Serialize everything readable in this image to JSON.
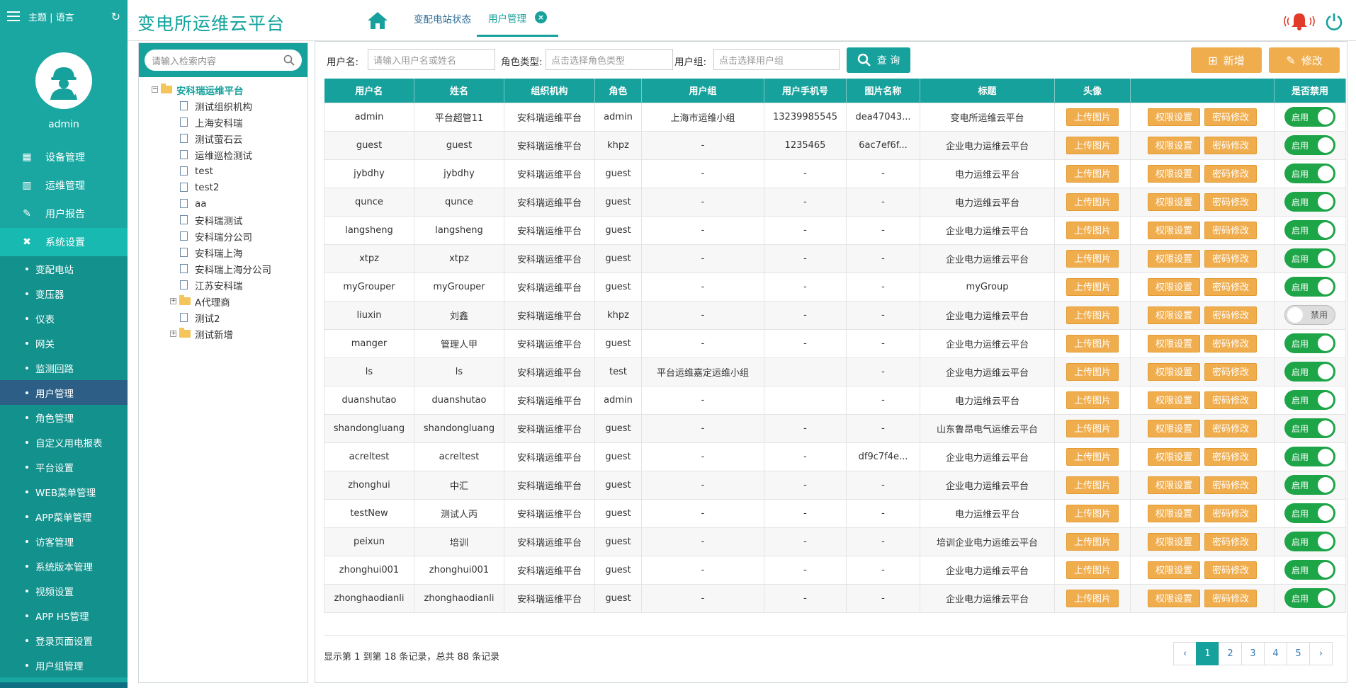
{
  "sidebar": {
    "top_label": "主题 | 语言",
    "user": "admin",
    "nav": [
      {
        "label": "设备管理",
        "icon": "calendar-icon"
      },
      {
        "label": "运维管理",
        "icon": "grid-icon"
      },
      {
        "label": "用户报告",
        "icon": "edit-icon"
      },
      {
        "label": "系统设置",
        "icon": "tools-icon"
      }
    ],
    "sub": [
      "变配电站",
      "变压器",
      "仪表",
      "网关",
      "监测回路",
      "用户管理",
      "角色管理",
      "自定义用电报表",
      "平台设置",
      "WEB菜单管理",
      "APP菜单管理",
      "访客管理",
      "系统版本管理",
      "视频设置",
      "APP H5管理",
      "登录页面设置",
      "用户组管理"
    ]
  },
  "header": {
    "title": "变电所运维云平台",
    "tabs": [
      "变配电站状态",
      "用户管理"
    ]
  },
  "tree": {
    "search_placeholder": "请输入检索内容",
    "root": "安科瑞运维平台",
    "children": [
      "测试组织机构",
      "上海安科瑞",
      "测试萤石云",
      "运维巡检测试",
      "test",
      "test2",
      "aa",
      "安科瑞测试",
      "安科瑞分公司",
      "安科瑞上海",
      "安科瑞上海分公司",
      "江苏安科瑞"
    ],
    "folders": [
      "A代理商",
      "测试2",
      "测试新增"
    ]
  },
  "toolbar": {
    "username_label": "用户名:",
    "username_placeholder": "请输入用户名或姓名",
    "role_label": "角色类型:",
    "role_placeholder": "点击选择角色类型",
    "group_label": "用户组:",
    "group_placeholder": "点击选择用户组",
    "query": "查 询",
    "add": "新增",
    "edit": "修改"
  },
  "table": {
    "headers": [
      "用户名",
      "姓名",
      "组织机构",
      "角色",
      "用户组",
      "用户手机号",
      "图片名称",
      "标题",
      "头像",
      "",
      "是否禁用"
    ],
    "btn_upload": "上传图片",
    "btn_perm": "权限设置",
    "btn_pwd": "密码修改",
    "on_label": "启用",
    "off_label": "禁用",
    "rows": [
      [
        "admin",
        "平台超管11",
        "安科瑞运维平台",
        "admin",
        "上海市运维小组",
        "13239985545",
        "dea47043...",
        "变电所运维云平台",
        true
      ],
      [
        "guest",
        "guest",
        "安科瑞运维平台",
        "khpz",
        "-",
        "1235465",
        "6ac7ef6f...",
        "企业电力运维云平台",
        true
      ],
      [
        "jybdhy",
        "jybdhy",
        "安科瑞运维平台",
        "guest",
        "-",
        "-",
        "-",
        "电力运维云平台",
        true
      ],
      [
        "qunce",
        "qunce",
        "安科瑞运维平台",
        "guest",
        "-",
        "-",
        "-",
        "电力运维云平台",
        true
      ],
      [
        "langsheng",
        "langsheng",
        "安科瑞运维平台",
        "guest",
        "-",
        "-",
        "-",
        "企业电力运维云平台",
        true
      ],
      [
        "xtpz",
        "xtpz",
        "安科瑞运维平台",
        "guest",
        "-",
        "-",
        "-",
        "企业电力运维云平台",
        true
      ],
      [
        "myGrouper",
        "myGrouper",
        "安科瑞运维平台",
        "guest",
        "-",
        "-",
        "-",
        "myGroup",
        true
      ],
      [
        "liuxin",
        "刘鑫",
        "安科瑞运维平台",
        "khpz",
        "-",
        "-",
        "-",
        "企业电力运维云平台",
        false
      ],
      [
        "manger",
        "管理人甲",
        "安科瑞运维平台",
        "guest",
        "-",
        "-",
        "-",
        "企业电力运维云平台",
        true
      ],
      [
        "ls",
        "ls",
        "安科瑞运维平台",
        "test",
        "平台运维嘉定运维小组",
        "",
        "-",
        "企业电力运维云平台",
        true
      ],
      [
        "duanshutao",
        "duanshutao",
        "安科瑞运维平台",
        "admin",
        "-",
        "",
        "-",
        "电力运维云平台",
        true
      ],
      [
        "shandongluang",
        "shandongluang",
        "安科瑞运维平台",
        "guest",
        "-",
        "-",
        "-",
        "山东鲁昂电气运维云平台",
        true
      ],
      [
        "acreltest",
        "acreltest",
        "安科瑞运维平台",
        "guest",
        "-",
        "-",
        "df9c7f4e...",
        "企业电力运维云平台",
        true
      ],
      [
        "zhonghui",
        "中汇",
        "安科瑞运维平台",
        "guest",
        "-",
        "-",
        "-",
        "企业电力运维云平台",
        true
      ],
      [
        "testNew",
        "测试人丙",
        "安科瑞运维平台",
        "guest",
        "-",
        "-",
        "-",
        "电力运维云平台",
        true
      ],
      [
        "peixun",
        "培训",
        "安科瑞运维平台",
        "guest",
        "-",
        "-",
        "-",
        "培训企业电力运维云平台",
        true
      ],
      [
        "zhonghui001",
        "zhonghui001",
        "安科瑞运维平台",
        "guest",
        "-",
        "-",
        "-",
        "企业电力运维云平台",
        true
      ],
      [
        "zhonghaodianli",
        "zhonghaodianli",
        "安科瑞运维平台",
        "guest",
        "-",
        "-",
        "-",
        "企业电力运维云平台",
        true
      ]
    ]
  },
  "footer": {
    "summary": "显示第 1 到第 18 条记录，总共 88 条记录",
    "pages": [
      "‹",
      "1",
      "2",
      "3",
      "4",
      "5",
      "›"
    ]
  }
}
